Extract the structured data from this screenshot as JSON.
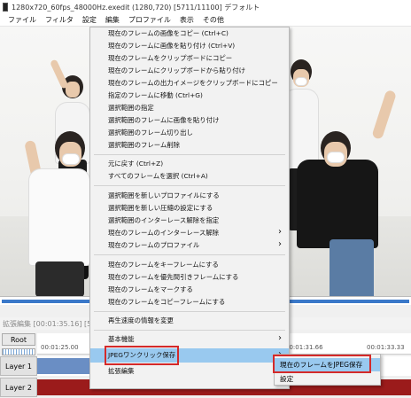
{
  "window": {
    "title": "1280x720_60fps_48000Hz.exedit (1280,720)  [5711/11100]  デフォルト"
  },
  "menubar": {
    "items": [
      "ファイル",
      "フィルタ",
      "設定",
      "編集",
      "プロファイル",
      "表示",
      "その他"
    ]
  },
  "context_menu": {
    "items": [
      {
        "label": "現在のフレームの画像をコピー (Ctrl+C)"
      },
      {
        "label": "現在のフレームに画像を貼り付け (Ctrl+V)"
      },
      {
        "label": "現在のフレームをクリップボードにコピー"
      },
      {
        "label": "現在のフレームにクリップボードから貼り付け"
      },
      {
        "label": "現在のフレームの出力イメージをクリップボードにコピー"
      },
      {
        "label": "指定のフレームに移動 (Ctrl+G)"
      },
      {
        "label": "選択範囲の指定"
      },
      {
        "label": "選択範囲のフレームに画像を貼り付け"
      },
      {
        "label": "選択範囲のフレーム切り出し"
      },
      {
        "label": "選択範囲のフレーム削除"
      },
      {
        "label": "元に戻す (Ctrl+Z)"
      },
      {
        "label": "すべてのフレームを選択 (Ctrl+A)"
      },
      {
        "label": "選択範囲を新しいプロファイルにする"
      },
      {
        "label": "選択範囲を新しい圧縮の設定にする"
      },
      {
        "label": "選択範囲のインターレース解除を指定"
      },
      {
        "label": "現在のフレームのインターレース解除"
      },
      {
        "label": "現在のフレームのプロファイル"
      },
      {
        "label": "現在のフレームをキーフレームにする"
      },
      {
        "label": "現在のフレームを優先間引きフレームにする"
      },
      {
        "label": "現在のフレームをマークする"
      },
      {
        "label": "現在のフレームをコピーフレームにする"
      },
      {
        "label": "再生速度の情報を変更"
      },
      {
        "label": "基本機能"
      },
      {
        "label": "JPEGワンクリック保存"
      },
      {
        "label": "拡張編集"
      }
    ]
  },
  "submenu": {
    "items": [
      {
        "label": "現在のフレームをJPEG保存"
      },
      {
        "label": "設定"
      }
    ]
  },
  "timeline": {
    "header_text": "拡張編集 [00:01:35.16] [5711/11100]",
    "root_label": "Root",
    "ticks": [
      "00:01:25.00",
      "00:01:31.66",
      "00:01:33.33"
    ],
    "layers": [
      {
        "label": "Layer 1"
      },
      {
        "label": "Layer 2"
      }
    ]
  },
  "colors": {
    "highlight": "#99c9ef",
    "annotation_red": "#d42a2a",
    "layer2_clip": "#9b1b1b",
    "progress_blue": "#3a78c9"
  }
}
